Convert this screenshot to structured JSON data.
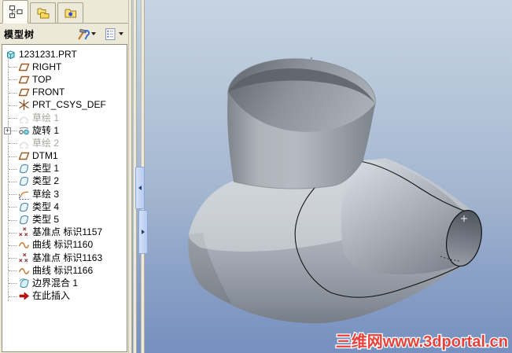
{
  "navigator": {
    "tabs": [
      {
        "id": "model-tree",
        "icon": "tab-model-tree",
        "active": true
      },
      {
        "id": "folder-browser",
        "icon": "tab-folder-browser",
        "active": false
      },
      {
        "id": "favorites",
        "icon": "tab-favorites",
        "active": false
      }
    ],
    "header": {
      "title": "模型树",
      "buttons": [
        {
          "id": "show",
          "icon": "show-tools"
        },
        {
          "id": "settings",
          "icon": "settings-list"
        }
      ]
    },
    "tree": {
      "items": [
        {
          "id": "part-root",
          "label": "1231231.PRT",
          "icon": "part",
          "level": 0
        },
        {
          "id": "plane-right",
          "label": "RIGHT",
          "icon": "datum-plane",
          "level": 1
        },
        {
          "id": "plane-top",
          "label": "TOP",
          "icon": "datum-plane",
          "level": 1
        },
        {
          "id": "plane-front",
          "label": "FRONT",
          "icon": "datum-plane",
          "level": 1
        },
        {
          "id": "csys",
          "label": "PRT_CSYS_DEF",
          "icon": "csys",
          "level": 1
        },
        {
          "id": "sketch-1",
          "label": "草绘 1",
          "icon": "sketch",
          "level": 1,
          "grayed": true
        },
        {
          "id": "revolve-1",
          "label": "旋转 1",
          "icon": "revolve",
          "level": 1,
          "expandable": true
        },
        {
          "id": "sketch-2",
          "label": "草绘 2",
          "icon": "sketch",
          "level": 1,
          "grayed": true
        },
        {
          "id": "dtm1",
          "label": "DTM1",
          "icon": "datum-plane",
          "level": 1
        },
        {
          "id": "style-1",
          "label": "类型 1",
          "icon": "surface",
          "level": 1
        },
        {
          "id": "style-2",
          "label": "类型 2",
          "icon": "surface",
          "level": 1
        },
        {
          "id": "sketch-3",
          "label": "草绘 3",
          "icon": "sketch-active",
          "level": 1
        },
        {
          "id": "style-4",
          "label": "类型 4",
          "icon": "surface",
          "level": 1
        },
        {
          "id": "style-5",
          "label": "类型 5",
          "icon": "surface",
          "level": 1
        },
        {
          "id": "point-1157",
          "label": "基准点 标识1157",
          "icon": "datum-point",
          "level": 1
        },
        {
          "id": "curve-1160",
          "label": "曲线 标识1160",
          "icon": "curve",
          "level": 1
        },
        {
          "id": "point-1163",
          "label": "基准点 标识1163",
          "icon": "datum-point",
          "level": 1
        },
        {
          "id": "curve-1166",
          "label": "曲线 标识1166",
          "icon": "curve",
          "level": 1
        },
        {
          "id": "boundary-blend-1",
          "label": "边界混合 1",
          "icon": "boundary-blend",
          "level": 1
        },
        {
          "id": "insert-here",
          "label": "在此插入",
          "icon": "insert-here",
          "level": 1
        }
      ]
    }
  },
  "viewport": {
    "watermark": "三维网www.3dportal.cn",
    "colors": {
      "background_top": "#c6d4e3",
      "background_bottom": "#7690bf",
      "model_gray": "#a8aeb6",
      "watermark_red": "#e8403a",
      "chrome_beige": "#ece9d8"
    }
  }
}
